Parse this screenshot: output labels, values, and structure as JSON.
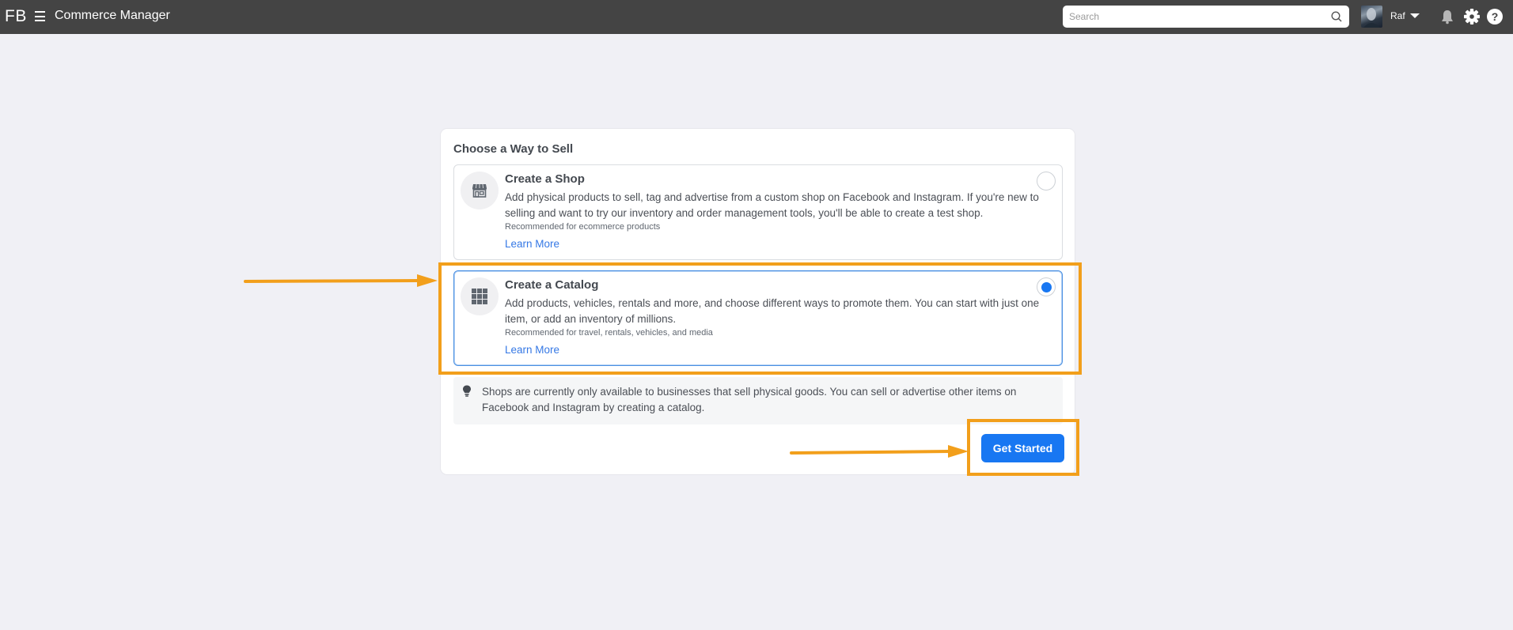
{
  "header": {
    "logo": "FB",
    "menu_icon": "hamburger-menu-icon",
    "app_title": "Commerce Manager",
    "search": {
      "placeholder": "Search",
      "value": "",
      "icon": "search-icon"
    },
    "user": {
      "name": "Raf",
      "avatar": "user-avatar",
      "dropdown_icon": "caret-down-icon"
    },
    "icons": [
      "bell-icon",
      "gear-icon",
      "help-icon"
    ]
  },
  "panel": {
    "title": "Choose a Way to Sell",
    "options": [
      {
        "id": "shop",
        "icon": "storefront-icon",
        "title": "Create a Shop",
        "description": "Add physical products to sell, tag and advertise from a custom shop on Facebook and Instagram. If you're new to selling and want to try our inventory and order management tools, you'll be able to create a test shop.",
        "recommendation": "Recommended for ecommerce products",
        "link": "Learn More",
        "selected": false
      },
      {
        "id": "catalog",
        "icon": "grid-icon",
        "title": "Create a Catalog",
        "description": "Add products, vehicles, rentals and more, and choose different ways to promote them. You can start with just one item, or add an inventory of millions.",
        "recommendation": "Recommended for travel, rentals, vehicles, and media",
        "link": "Learn More",
        "selected": true
      }
    ],
    "info": {
      "icon": "lightbulb-icon",
      "text": "Shops are currently only available to businesses that sell physical goods. You can sell or advertise other items on Facebook and Instagram by creating a catalog."
    },
    "primary_button": "Get Started"
  },
  "colors": {
    "topbar": "#444444",
    "background": "#f0f0f5",
    "accent_blue": "#1877f2",
    "link_blue": "#3578e5",
    "annotation_orange": "#f29f1b"
  }
}
